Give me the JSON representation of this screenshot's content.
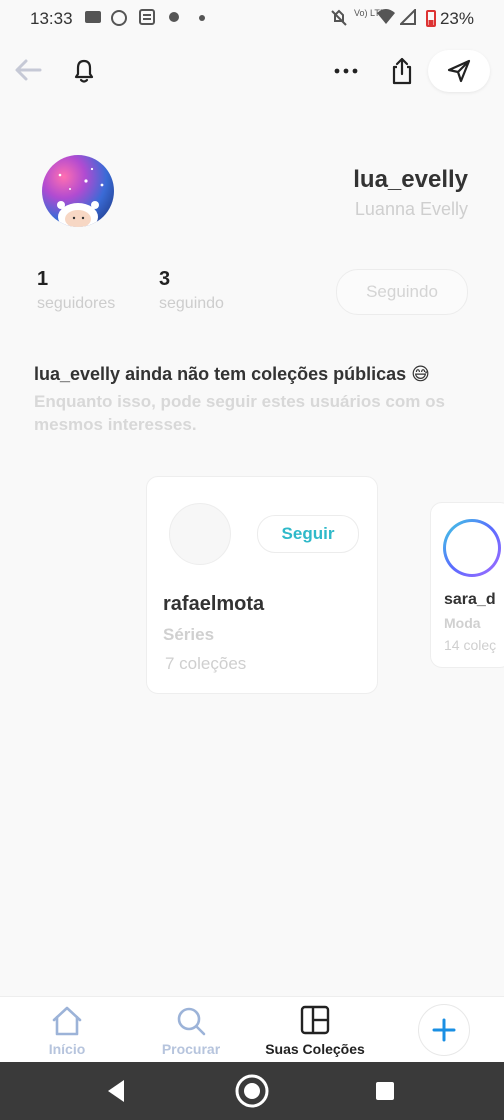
{
  "status_bar": {
    "time": "13:33",
    "battery": "23%",
    "net": "Vo) LTE"
  },
  "profile": {
    "username": "lua_evelly",
    "full_name": "Luanna  Evelly",
    "followers_count": "1",
    "followers_label": "seguidores",
    "following_count": "3",
    "following_label": "seguindo",
    "following_button": "Seguindo"
  },
  "empty_state": {
    "title": "lua_evelly ainda não tem coleções públicas 😅",
    "subtitle": "Enquanto isso, pode seguir estes usuários com os mesmos interesses."
  },
  "suggestions": [
    {
      "name": "rafaelmota",
      "category": "Séries",
      "collections": "7 coleções",
      "follow_label": "Seguir"
    },
    {
      "name": "sara_d",
      "category": "Moda",
      "collections": "14 coleç"
    }
  ],
  "bottom_nav": {
    "home": "Início",
    "search": "Procurar",
    "collections": "Suas Coleções"
  },
  "colors": {
    "accent": "#2fb9c9",
    "plus": "#1a8fe3"
  }
}
